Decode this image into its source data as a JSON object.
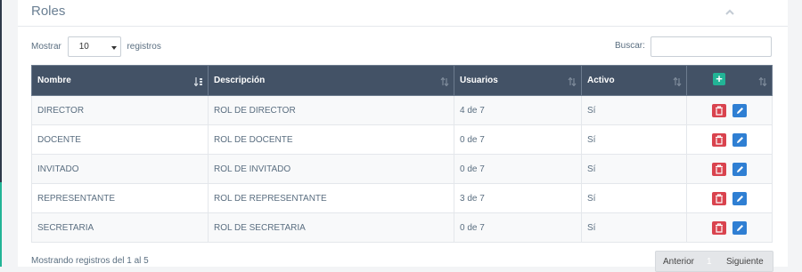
{
  "panel": {
    "title": "Roles"
  },
  "toolbar": {
    "show_label": "Mostrar",
    "page_size": "10",
    "records_label": "registros",
    "search_label": "Buscar:",
    "search_value": ""
  },
  "table": {
    "headers": {
      "nombre": "Nombre",
      "descripcion": "Descripción",
      "usuarios": "Usuarios",
      "activo": "Activo",
      "add": "+"
    },
    "rows": [
      {
        "nombre": "DIRECTOR",
        "descripcion": "ROL DE DIRECTOR",
        "usuarios": "4 de 7",
        "activo": "Sí"
      },
      {
        "nombre": "DOCENTE",
        "descripcion": "ROL DE DOCENTE",
        "usuarios": "0 de 7",
        "activo": "Sí"
      },
      {
        "nombre": "INVITADO",
        "descripcion": "ROL DE INVITADO",
        "usuarios": "0 de 7",
        "activo": "Sí"
      },
      {
        "nombre": "REPRESENTANTE",
        "descripcion": "ROL DE REPRESENTANTE",
        "usuarios": "3 de 7",
        "activo": "Sí"
      },
      {
        "nombre": "SECRETARIA",
        "descripcion": "ROL DE SECRETARIA",
        "usuarios": "0 de 7",
        "activo": "Sí"
      }
    ]
  },
  "footer": {
    "info": "Mostrando registros del 1 al 5",
    "prev": "Anterior",
    "current_page": "1",
    "next": "Siguiente"
  },
  "colors": {
    "header_bg": "#435266",
    "add": "#22b496",
    "delete": "#d9434e",
    "edit": "#2f7fd3"
  },
  "icons": {
    "collapse": "chevron-up-icon",
    "page_size_caret": "caret-down-icon",
    "sort_active": "sort-alpha-asc-icon",
    "sort": "sort-icon",
    "add": "plus-icon",
    "delete": "trash-icon",
    "edit": "pencil-icon"
  }
}
